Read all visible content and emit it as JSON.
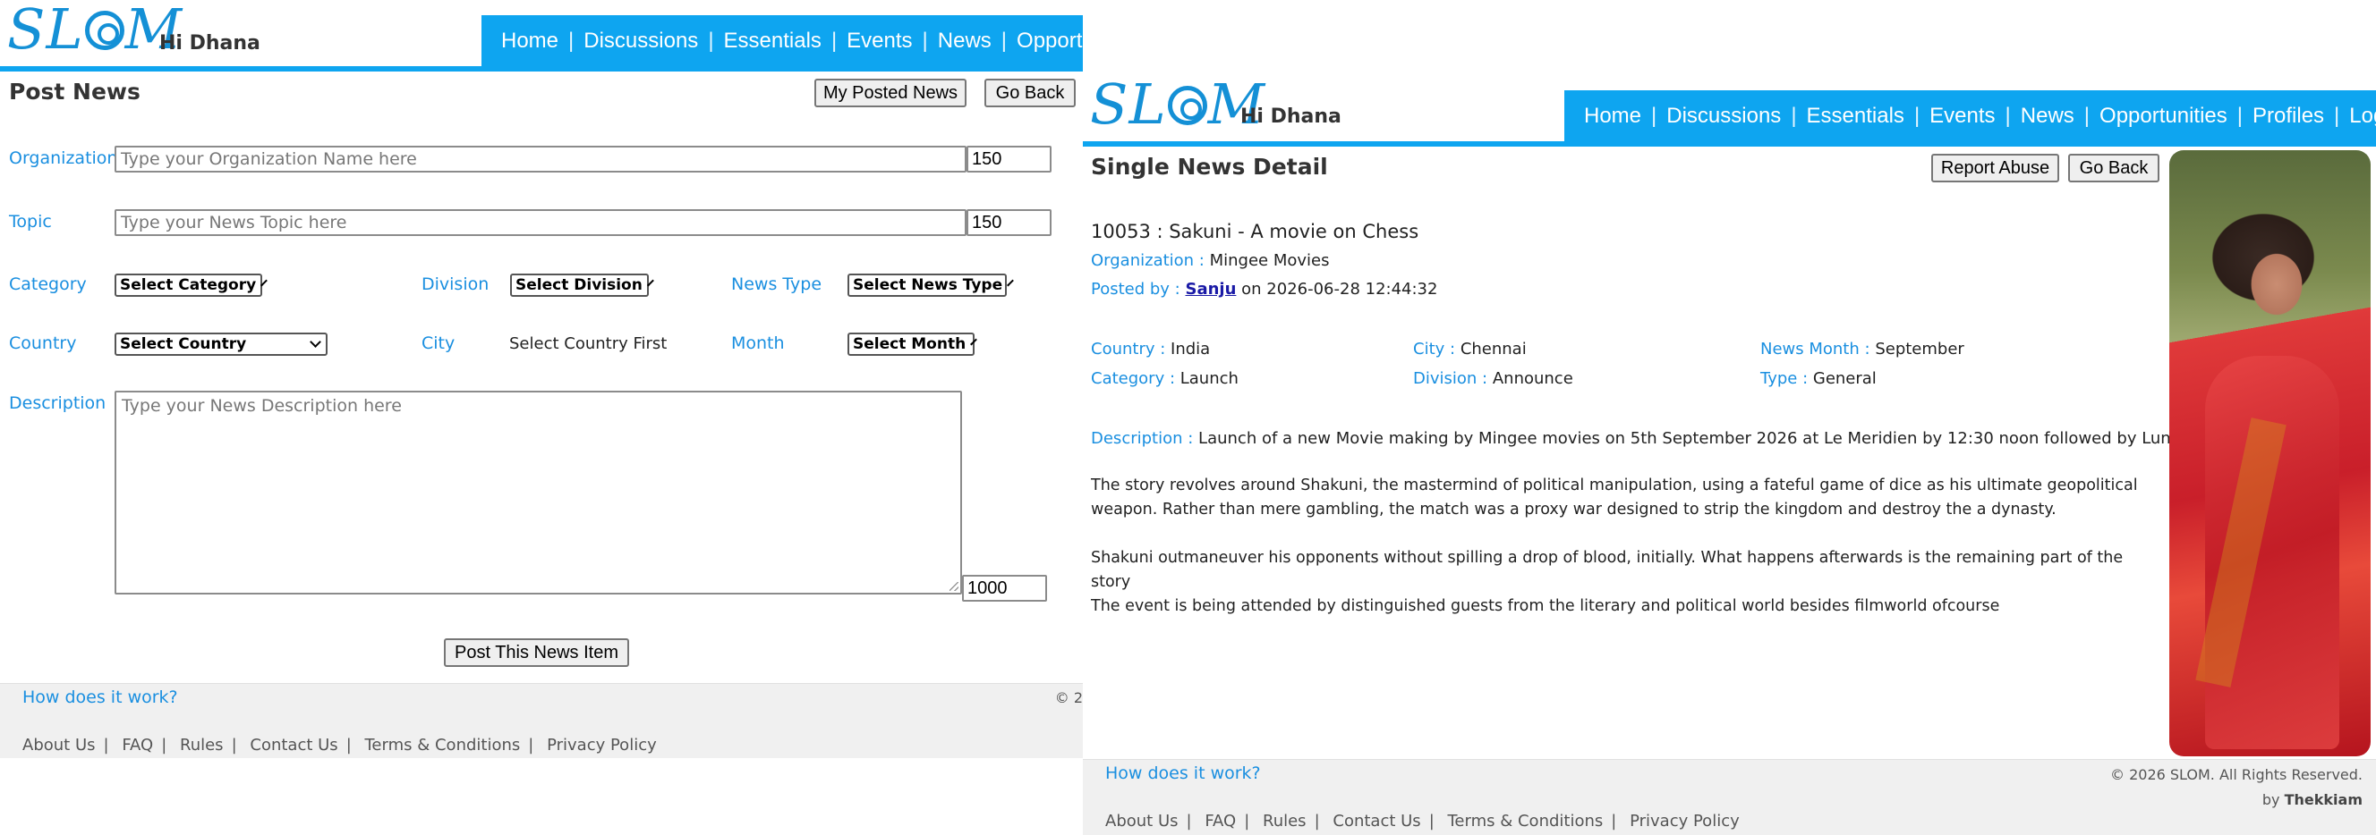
{
  "header": {
    "logo": "SLOM",
    "greeting": "Hi Dhana",
    "nav": [
      "Home",
      "Discussions",
      "Essentials",
      "Events",
      "News",
      "Opportunities",
      "Profiles",
      "Logout"
    ]
  },
  "post_news": {
    "title": "Post News",
    "my_posted_label": "My Posted News",
    "go_back_label": "Go Back",
    "organization": {
      "label": "Organization",
      "placeholder": "Type your Organization Name here",
      "counter": "150"
    },
    "topic": {
      "label": "Topic",
      "placeholder": "Type your News Topic here",
      "counter": "150"
    },
    "category": {
      "label": "Category",
      "value": "Select Category"
    },
    "division": {
      "label": "Division",
      "value": "Select Division"
    },
    "news_type": {
      "label": "News Type",
      "value": "Select News Type"
    },
    "country": {
      "label": "Country",
      "value": "Select Country"
    },
    "city": {
      "label": "City",
      "value": "Select Country First"
    },
    "month": {
      "label": "Month",
      "value": "Select Month"
    },
    "description": {
      "label": "Description",
      "placeholder": "Type your News Description here",
      "counter": "1000"
    },
    "submit_label": "Post This News Item"
  },
  "footer": {
    "how": "How does it work?",
    "links": [
      "About Us",
      "FAQ",
      "Rules",
      "Contact Us",
      "Terms & Conditions",
      "Privacy Policy"
    ],
    "copyright": "© 2026 SLOM. All Rights Reserved.",
    "copyright_clipped": "© 2",
    "by_prefix": "by ",
    "by_name": "Thekkiam"
  },
  "news_detail": {
    "title": "Single News Detail",
    "report_label": "Report Abuse",
    "go_back_label": "Go Back",
    "headline": "10053 : Sakuni - A movie on Chess",
    "organization_key": "Organization :",
    "organization_value": "Mingee Movies",
    "posted_key": "Posted by :",
    "posted_user": "Sanju",
    "posted_on": "on 2026-06-28 12:44:32",
    "country_key": "Country :",
    "country_value": "India",
    "city_key": "City :",
    "city_value": "Chennai",
    "month_key": "News Month :",
    "month_value": "September",
    "category_key": "Category :",
    "category_value": "Launch",
    "division_key": "Division :",
    "division_value": "Announce",
    "type_key": "Type :",
    "type_value": "General",
    "description_key": "Description :",
    "description_value": "Launch of a new Movie making by Mingee movies on 5th September 2026 at Le Meridien by 12:30 noon followed by Lunch",
    "para1": "The story revolves around Shakuni, the mastermind of political manipulation, using a fateful game of dice as his ultimate geopolitical weapon. Rather than mere gambling, the match was a proxy war designed to strip the kingdom and destroy the a dynasty.",
    "para2": "Shakuni outmaneuver his opponents without spilling a drop of blood, initially. What happens afterwards is the remaining part of the story",
    "para3": "The event is being attended by distinguished guests from the literary and political world besides filmworld ofcourse"
  }
}
